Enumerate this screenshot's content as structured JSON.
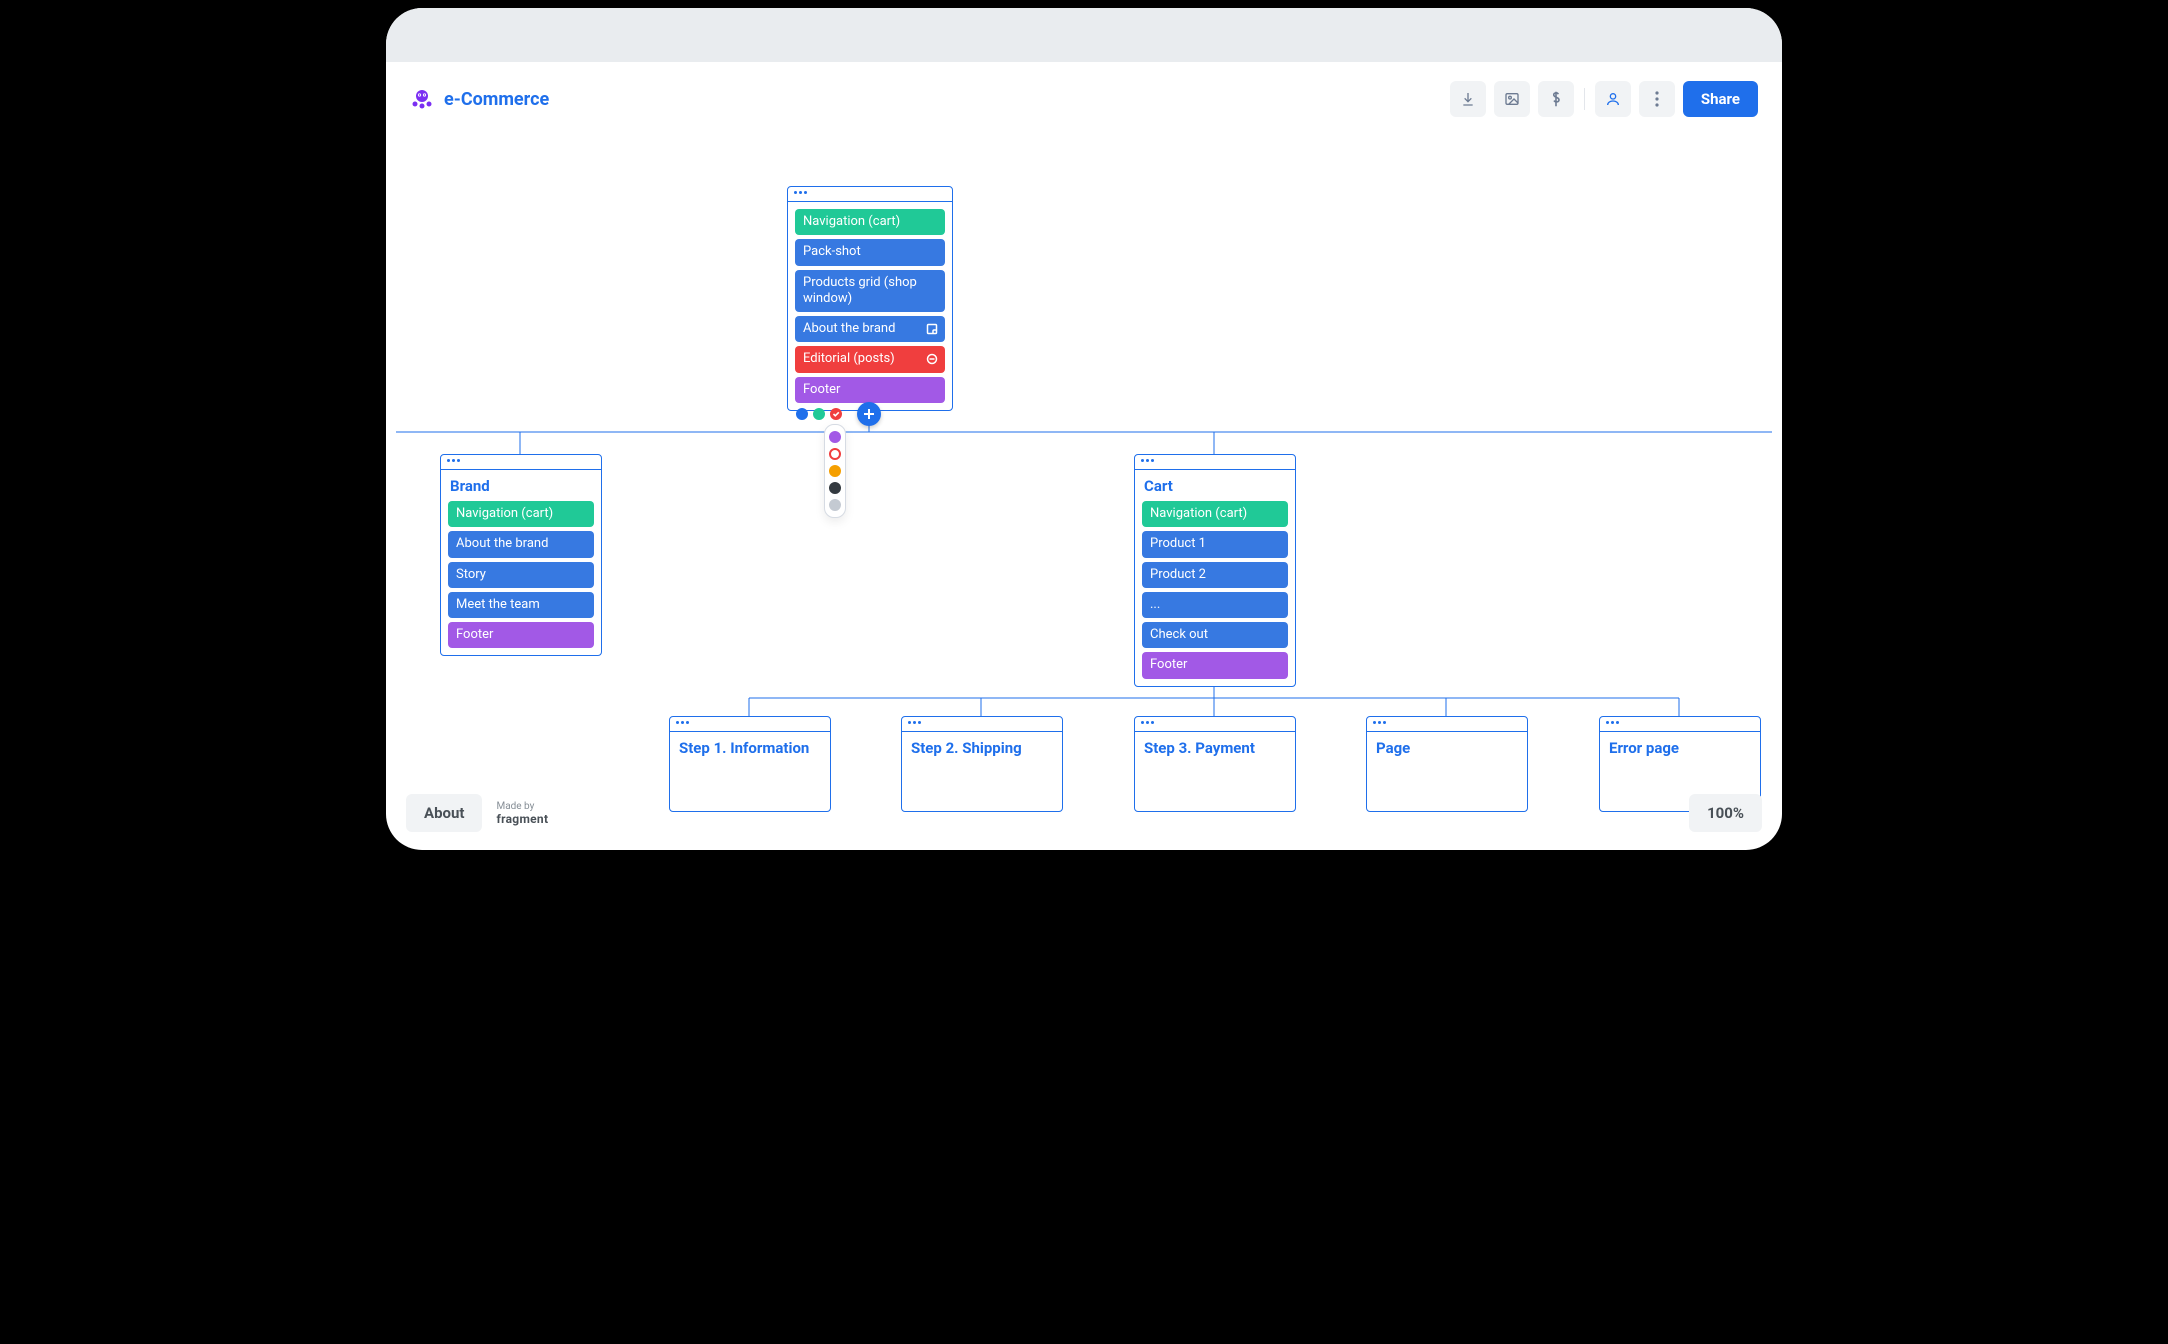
{
  "project_title": "e-Commerce",
  "toolbar": {
    "share_label": "Share"
  },
  "footer": {
    "about_label": "About",
    "made_by_label": "Made by",
    "made_by_brand": "fragment"
  },
  "zoom_label": "100%",
  "colors": {
    "teal": "#20C997",
    "blue": "#3779E1",
    "purple": "#A259E6",
    "red": "#F03E3E",
    "orange": "#F59F00",
    "dark": "#343A40",
    "gray": "#ADB5BD",
    "brand_blue": "#1F6FEB"
  },
  "status_dots": [
    "blue",
    "teal",
    "red"
  ],
  "color_menu": [
    "purple",
    "red-outline",
    "orange",
    "dark",
    "gray"
  ],
  "cards": {
    "root": {
      "title": "",
      "blocks": [
        {
          "label": "Navigation (cart)",
          "color": "teal"
        },
        {
          "label": "Pack-shot",
          "color": "blue"
        },
        {
          "label": "Products grid (shop window)",
          "color": "blue"
        },
        {
          "label": "About the brand",
          "color": "blue",
          "icon": "note"
        },
        {
          "label": "Editorial (posts)",
          "color": "red",
          "icon": "minus"
        },
        {
          "label": "Footer",
          "color": "purple"
        }
      ]
    },
    "brand": {
      "title": "Brand",
      "blocks": [
        {
          "label": "Navigation (cart)",
          "color": "teal"
        },
        {
          "label": "About the brand",
          "color": "blue"
        },
        {
          "label": "Story",
          "color": "blue"
        },
        {
          "label": "Meet the team",
          "color": "blue"
        },
        {
          "label": "Footer",
          "color": "purple"
        }
      ]
    },
    "cart": {
      "title": "Cart",
      "blocks": [
        {
          "label": "Navigation (cart)",
          "color": "teal"
        },
        {
          "label": "Product 1",
          "color": "blue"
        },
        {
          "label": "Product 2",
          "color": "blue"
        },
        {
          "label": "...",
          "color": "blue"
        },
        {
          "label": "Check out",
          "color": "blue"
        },
        {
          "label": "Footer",
          "color": "purple"
        }
      ]
    },
    "step1": {
      "title": "Step 1. Information"
    },
    "step2": {
      "title": "Step 2. Shipping"
    },
    "step3": {
      "title": "Step 3. Payment"
    },
    "page": {
      "title": "Page"
    },
    "error": {
      "title": "Error page"
    }
  }
}
